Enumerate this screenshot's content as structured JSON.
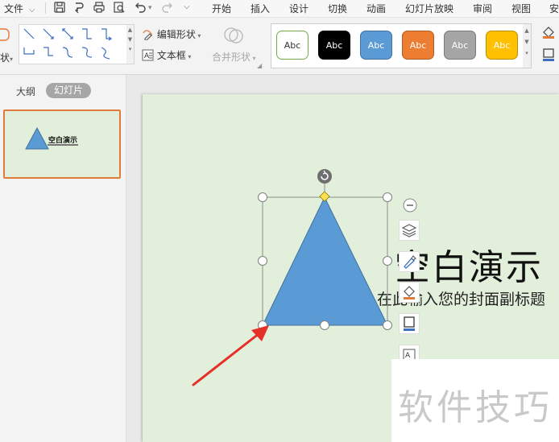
{
  "menu_bar": {
    "file_menu": "文件",
    "tabs": [
      {
        "label": "开始"
      },
      {
        "label": "插入"
      },
      {
        "label": "设计"
      },
      {
        "label": "切换"
      },
      {
        "label": "动画"
      },
      {
        "label": "幻灯片放映"
      },
      {
        "label": "审阅"
      },
      {
        "label": "视图"
      },
      {
        "label": "安"
      }
    ],
    "quick_access_icons": [
      "save-icon",
      "undo-history-icon",
      "print-icon",
      "print-preview-icon",
      "undo-icon",
      "redo-icon",
      "dropdown-icon"
    ]
  },
  "ribbon": {
    "partial_label": "状",
    "edit_shape_label": "编辑形状",
    "text_box_label": "文本框",
    "merge_shape_label": "合并形状",
    "style_swatches": [
      {
        "label": "Abc",
        "fill": "#ffffff",
        "border": "#70ad47",
        "text_color": "#333333"
      },
      {
        "label": "Abc",
        "fill": "#000000",
        "border": "#000000",
        "text_color": "#ffffff"
      },
      {
        "label": "Abc",
        "fill": "#5b9bd5",
        "border": "#41719c",
        "text_color": "#ffffff",
        "selected": true
      },
      {
        "label": "Abc",
        "fill": "#ed7d31",
        "border": "#ae5a21",
        "text_color": "#ffffff"
      },
      {
        "label": "Abc",
        "fill": "#a5a5a5",
        "border": "#787878",
        "text_color": "#ffffff"
      },
      {
        "label": "Abc",
        "fill": "#ffc000",
        "border": "#bc8c00",
        "text_color": "#ffffff"
      }
    ]
  },
  "left_panel": {
    "tab_outline": "大纲",
    "tab_slides": "幻灯片",
    "thumbnail_title": "空白演示"
  },
  "slide": {
    "background": "#e2efda",
    "title": "空白演示",
    "subtitle": "在此输入您的封面副标题",
    "shape": {
      "type": "triangle",
      "fill": "#5b9bd5",
      "stroke": "#41719c"
    }
  },
  "floating_toolbar_icons": [
    "collapse-icon",
    "layers-icon",
    "brush-icon",
    "fill-icon",
    "outline-icon",
    "text-icon"
  ],
  "watermark": "软件技巧",
  "colors": {
    "accent_orange": "#e07b3c",
    "arrow_red": "#e5302a",
    "selection_handle": "#7f7f7f"
  }
}
